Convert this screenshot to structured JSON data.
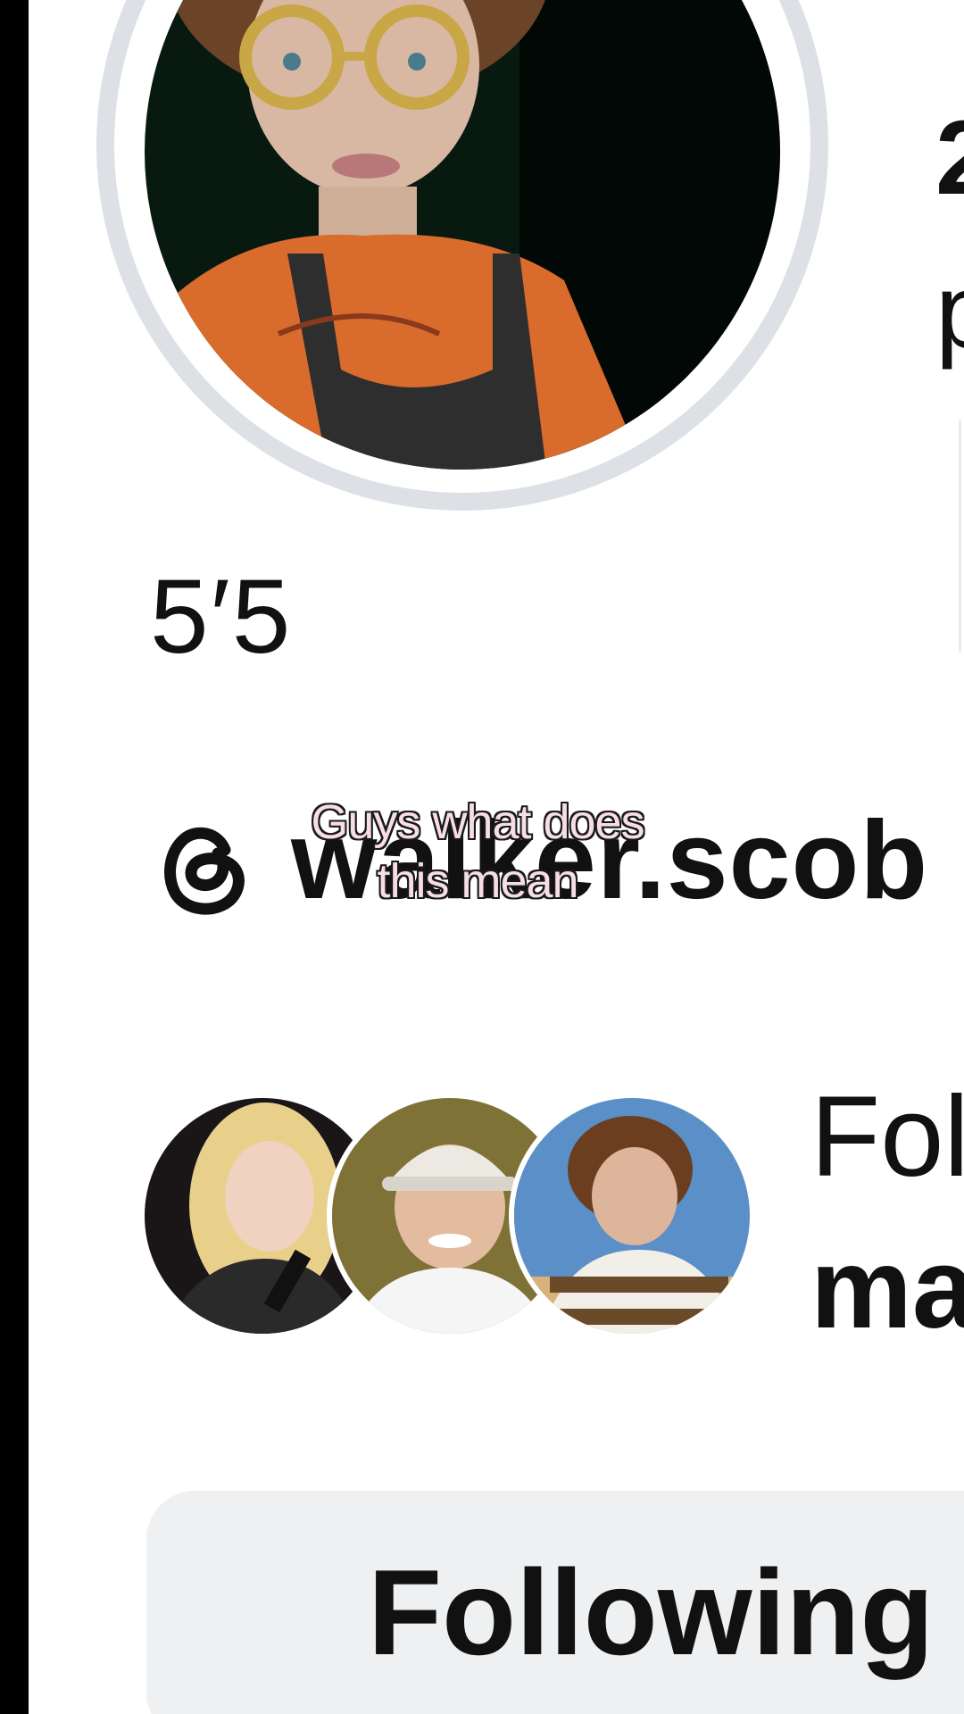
{
  "profile": {
    "stats": {
      "posts_value_partial": "2",
      "posts_label_partial": "p"
    },
    "bio": "5′5",
    "threads": {
      "icon": "threads-icon",
      "handle_partial": "walker.scob"
    },
    "followed_by": {
      "line1_partial": "Fol",
      "line2_partial": "ma",
      "avatar_count": 3
    },
    "follow_button_label": "Following"
  },
  "overlay": {
    "caption_line1": "Guys what does",
    "caption_line2": "this mean"
  },
  "colors": {
    "text": "#111111",
    "button_bg": "#eff0f2",
    "avatar_ring": "#dde1e6",
    "caption_fill": "#f7dde6"
  }
}
